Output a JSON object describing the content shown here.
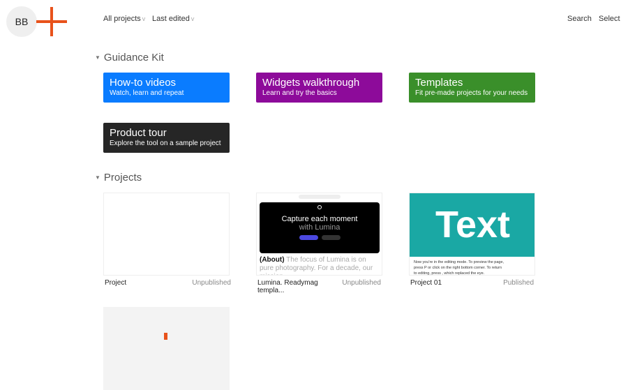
{
  "header": {
    "avatar_initials": "BB",
    "filter_projects": "All projects",
    "filter_sort": "Last edited",
    "chevron": "v",
    "search": "Search",
    "select": "Select",
    "brand_color": "#e8521b"
  },
  "guidance": {
    "title": "Guidance Kit",
    "cards": [
      {
        "title": "How-to videos",
        "subtitle": "Watch, learn and repeat",
        "color": "#0a7cff"
      },
      {
        "title": "Widgets walkthrough",
        "subtitle": "Learn and try the basics",
        "color": "#8d0b9a"
      },
      {
        "title": "Templates",
        "subtitle": "Fit pre-made projects for your needs",
        "color": "#3a8f2a"
      },
      {
        "title": "Product tour",
        "subtitle": "Explore the tool on a sample project",
        "color": "#262626"
      }
    ]
  },
  "projects": {
    "title": "Projects",
    "items": [
      {
        "name": "Project",
        "status": "Unpublished"
      },
      {
        "name": "Lumina. Readymag templa...",
        "status": "Unpublished",
        "thumb": {
          "headline": "Capture each moment",
          "subline": "with Lumina",
          "about_label": "(About)",
          "about_text": "The focus of Lumina is on pure photography. For a decade, our mission"
        }
      },
      {
        "name": "Project 01",
        "status": "Published",
        "thumb": {
          "big": "Text",
          "body": "Now you're in the editing mode. To preview the page, press P or click on the right bottom corner. To return to editing, press , which replaced the eye."
        }
      }
    ]
  }
}
